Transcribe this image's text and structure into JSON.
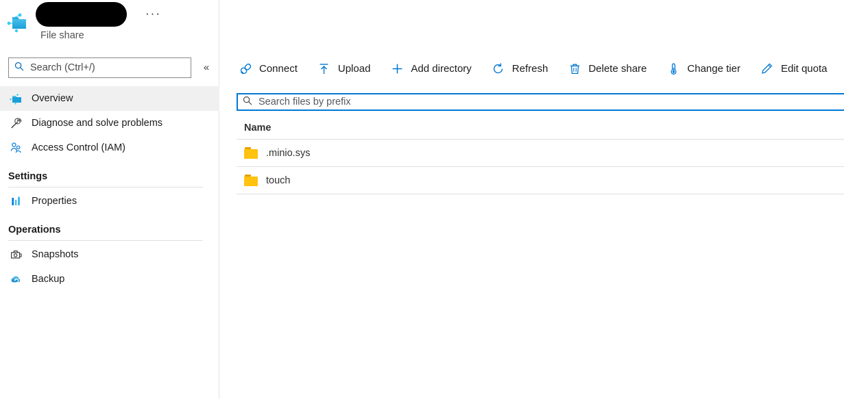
{
  "blade": {
    "resource_name_redacted": true,
    "resource_type": "File share",
    "more_actions_label": "···",
    "collapse_label": "«",
    "resource_icon": "file-share-icon"
  },
  "sidebar": {
    "search": {
      "placeholder": "Search (Ctrl+/)",
      "value": "",
      "icon": "search-icon"
    },
    "items": [
      {
        "label": "Overview",
        "icon": "file-share-icon",
        "selected": true
      },
      {
        "label": "Diagnose and solve problems",
        "icon": "wrench-icon",
        "selected": false
      },
      {
        "label": "Access Control (IAM)",
        "icon": "people-icon",
        "selected": false
      }
    ],
    "sections": [
      {
        "title": "Settings",
        "items": [
          {
            "label": "Properties",
            "icon": "bar-chart-icon",
            "selected": false
          }
        ]
      },
      {
        "title": "Operations",
        "items": [
          {
            "label": "Snapshots",
            "icon": "camera-snapshot-icon",
            "selected": false
          },
          {
            "label": "Backup",
            "icon": "cloud-backup-icon",
            "selected": false
          }
        ]
      }
    ]
  },
  "toolbar": {
    "buttons": [
      {
        "label": "Connect",
        "icon": "plug-connect-icon"
      },
      {
        "label": "Upload",
        "icon": "upload-arrow-icon"
      },
      {
        "label": "Add directory",
        "icon": "plus-icon"
      },
      {
        "label": "Refresh",
        "icon": "refresh-icon"
      },
      {
        "label": "Delete share",
        "icon": "trash-icon"
      },
      {
        "label": "Change tier",
        "icon": "thermometer-icon"
      },
      {
        "label": "Edit quota",
        "icon": "pencil-icon"
      }
    ]
  },
  "file_search": {
    "placeholder": "Search files by prefix",
    "value": "",
    "icon": "search-icon",
    "focused": true
  },
  "file_table": {
    "columns": [
      "Name"
    ],
    "rows": [
      {
        "name": ".minio.sys",
        "icon": "folder-icon"
      },
      {
        "name": "touch",
        "icon": "folder-icon"
      }
    ]
  },
  "colors": {
    "accent": "#0078d4",
    "folder": "#ffc20e",
    "selected_row": "#f0f0f0",
    "border": "#e1dfdd"
  }
}
